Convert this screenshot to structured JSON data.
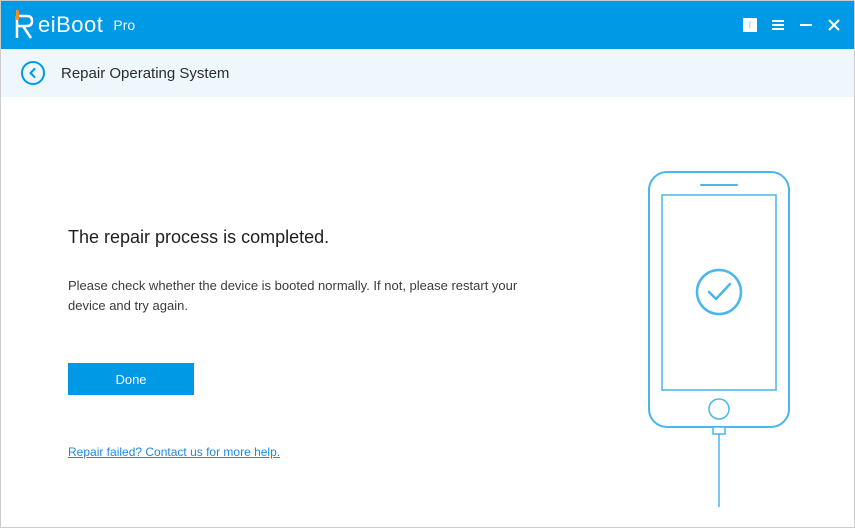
{
  "titlebar": {
    "brand_main": "eiBoot",
    "brand_sub": "Pro"
  },
  "breadcrumb": {
    "title": "Repair Operating System"
  },
  "main": {
    "heading": "The repair process is completed.",
    "description": "Please check whether the device is booted normally. If not, please restart your device and try again.",
    "done_label": "Done",
    "help_link": "Repair failed? Contact us for more help."
  },
  "colors": {
    "accent": "#0099e6"
  }
}
